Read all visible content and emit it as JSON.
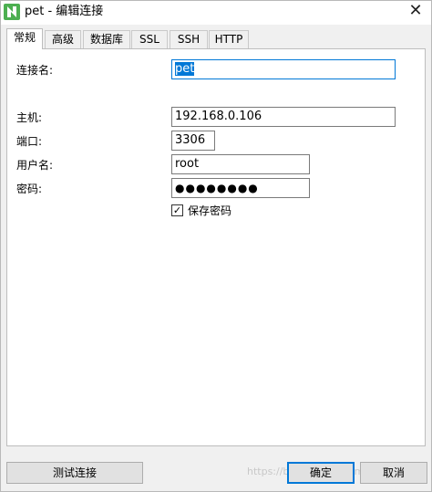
{
  "window": {
    "title": "pet - 编辑连接",
    "app_icon": "navicat-logo-icon",
    "close_icon": "close-icon",
    "close_glyph": "✕",
    "accent_color": "#0078d7",
    "icon_color": "#4caf50"
  },
  "tabs": [
    {
      "label": "常规",
      "active": true
    },
    {
      "label": "高级",
      "active": false
    },
    {
      "label": "数据库",
      "active": false
    },
    {
      "label": "SSL",
      "active": false
    },
    {
      "label": "SSH",
      "active": false
    },
    {
      "label": "HTTP",
      "active": false
    }
  ],
  "form": {
    "connection_name": {
      "label": "连接名:",
      "value": "pet"
    },
    "host": {
      "label": "主机:",
      "value": "192.168.0.106"
    },
    "port": {
      "label": "端口:",
      "value": "3306"
    },
    "username": {
      "label": "用户名:",
      "value": "root"
    },
    "password": {
      "label": "密码:",
      "value": "●●●●●●●●"
    },
    "save_password": {
      "label": "保存密码",
      "checked": true,
      "check_glyph": "✓"
    }
  },
  "buttons": {
    "test_connection": "测试连接",
    "ok": "确定",
    "cancel": "取消"
  },
  "watermark": "https://blog.csdn.net/m0_45..."
}
